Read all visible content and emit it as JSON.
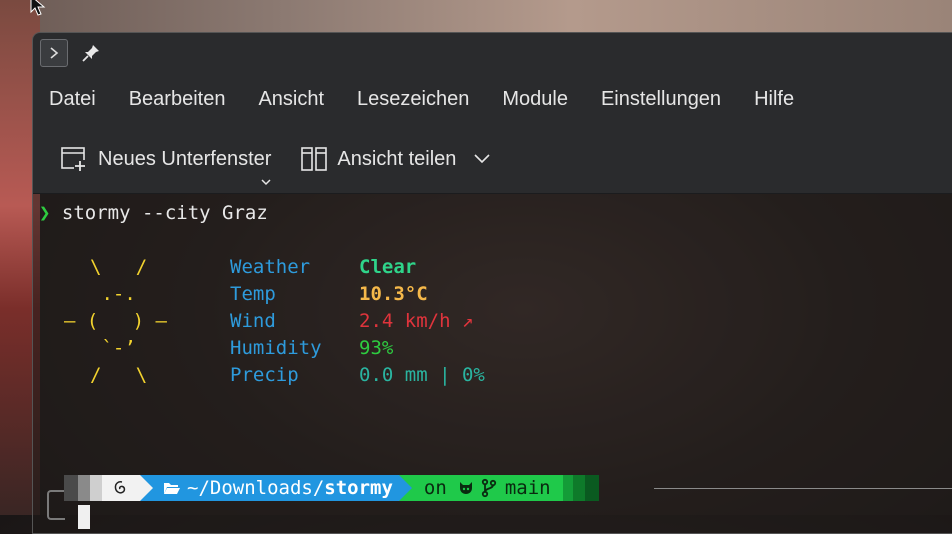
{
  "window": {
    "titlebar": {
      "terminal_icon": "terminal-chevron-icon",
      "pin_icon": "pin-icon"
    },
    "menu": [
      "Datei",
      "Bearbeiten",
      "Ansicht",
      "Lesezeichen",
      "Module",
      "Einstellungen",
      "Hilfe"
    ],
    "toolbar": {
      "new_tab_label": "Neues Unterfenster",
      "split_view_label": "Ansicht teilen"
    }
  },
  "terminal": {
    "command_prompt": "❯",
    "command": "stormy --city Graz",
    "weather_art": [
      "\\   /",
      " .-.",
      "– (   ) –",
      " `-’",
      "/   \\"
    ],
    "weather": {
      "labels": [
        "Weather",
        "Temp",
        "Wind",
        "Humidity",
        "Precip"
      ],
      "condition": "Clear",
      "temp": "10.3°C",
      "wind": "2.4 km/h ↗",
      "humidity": "93%",
      "precip": "0.0 mm | 0%"
    },
    "powerline": {
      "path_prefix": "~/Downloads/",
      "path_dir": "stormy",
      "git_on": "on",
      "branch": "main"
    }
  },
  "colors": {
    "prompt_green": "#2ecc40",
    "label_blue": "#2e9bdc",
    "sun_yellow": "#f2d22e",
    "path_blue": "#2196e0",
    "git_green": "#1fc94a"
  }
}
